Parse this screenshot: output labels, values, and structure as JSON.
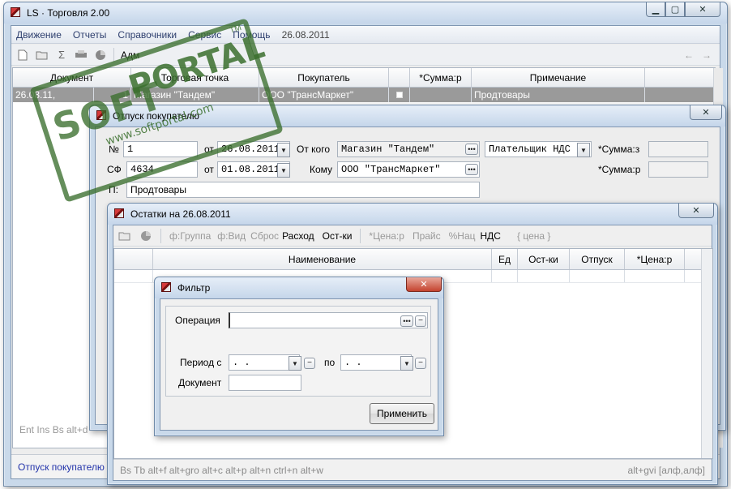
{
  "main": {
    "title": "LS · Торговля 2.00",
    "menu": [
      "Движение",
      "Отчеты",
      "Справочники",
      "Сервис",
      "Помощь",
      "26.08.2011"
    ],
    "toolbar": {
      "adm_label": "Адм",
      "back": "←",
      "forward": "→"
    },
    "grid": {
      "columns": [
        "Документ",
        "Торговая точка",
        "Покупатель",
        "",
        "*Сумма:р",
        "Примечание"
      ],
      "rows": [
        [
          "26.08.11,",
          "1",
          "Магазин \"Тандем\"",
          "ООО \"ТрансМаркет\"",
          "",
          "",
          "Продтовары"
        ]
      ]
    },
    "status_left": "Ent  Ins  Bs alt+d",
    "tab": "Отпуск покупателю"
  },
  "shipment": {
    "title": "Отпуск покупателю",
    "no_label": "№",
    "no_value": "1",
    "date_label": "от",
    "date_value": "26.08.2011",
    "from_label": "От кого",
    "from_value": "Магазин \"Тандем\"",
    "payer_value": "Плательщик НДС",
    "sum_z_label": "*Сумма:з",
    "sf_label": "СФ",
    "sf_value": "4634",
    "sf_date_label": "от",
    "sf_date_value": "01.08.2011",
    "to_label": "Кому",
    "to_value": "ООО \"ТрансМаркет\"",
    "sum_r_label": "*Сумма:р",
    "note_label": "П:",
    "note_value": "Продтовары"
  },
  "stock": {
    "title": "Остатки на  26.08.2011",
    "toolbar": [
      "ф:Группа",
      "ф:Вид",
      "Сброс",
      "Расход",
      "Ост-ки",
      "*Цена:р",
      "Прайс",
      "%Нац",
      "НДС",
      "{ цена }"
    ],
    "columns": [
      "",
      "Наименование",
      "Ед",
      "Ост-ки",
      "Отпуск",
      "*Цена:р"
    ],
    "status": {
      "left": "Bs Tb alt+f alt+gro alt+c alt+p alt+n ctrl+n alt+w",
      "right": "alt+gvi [алф,алф]"
    }
  },
  "filter": {
    "title": "Фильтр",
    "operation_label": "Операция",
    "operation_value": "",
    "period_label": "Период с",
    "period_from": " .  .",
    "period_to_label": "по",
    "period_to": " .  .",
    "doc_label": "Документ",
    "doc_value": "",
    "apply": "Применить"
  },
  "watermark": {
    "soft": "SOFT",
    "portal": "PORTAL",
    "url": "www.softportal.com",
    "tm": "TM"
  },
  "icons": {
    "close": "✕",
    "minimize": "▁",
    "maximize": "▢"
  }
}
